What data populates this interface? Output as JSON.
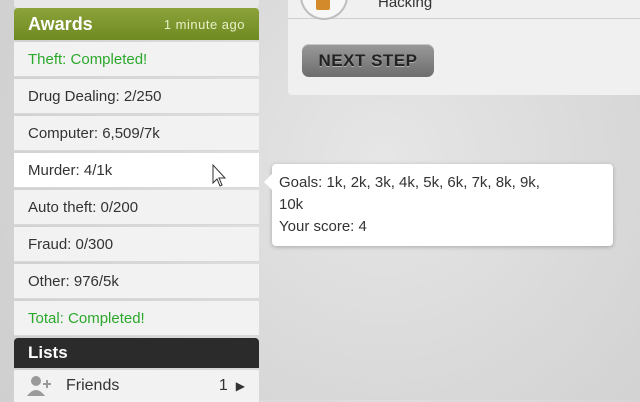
{
  "awards": {
    "title": "Awards",
    "time": "1 minute ago",
    "items": [
      {
        "label": "Theft: Completed!",
        "status": "completed"
      },
      {
        "label": "Drug Dealing: 2/250",
        "status": "progress"
      },
      {
        "label": "Computer: 6,509/7k",
        "status": "progress"
      },
      {
        "label": "Murder: 4/1k",
        "status": "progress"
      },
      {
        "label": "Auto theft: 0/200",
        "status": "progress"
      },
      {
        "label": "Fraud: 0/300",
        "status": "progress"
      },
      {
        "label": "Other: 976/5k",
        "status": "progress"
      },
      {
        "label": "Total: Completed!",
        "status": "completed"
      }
    ]
  },
  "lists": {
    "title": "Lists",
    "friends": {
      "label": "Friends",
      "count": "1",
      "icon": "add-friend-icon"
    }
  },
  "panel": {
    "activity_label": "Hacking",
    "next_button": "NEXT STEP"
  },
  "tooltip": {
    "goals_line1": "Goals: 1k, 2k, 3k, 4k, 5k, 6k, 7k, 8k, 9k,",
    "goals_line2": "10k",
    "score": "Your score: 4"
  },
  "colors": {
    "completed": "#2ca82c",
    "awards_header": "#7d9630",
    "lists_header": "#2b2b2b"
  }
}
